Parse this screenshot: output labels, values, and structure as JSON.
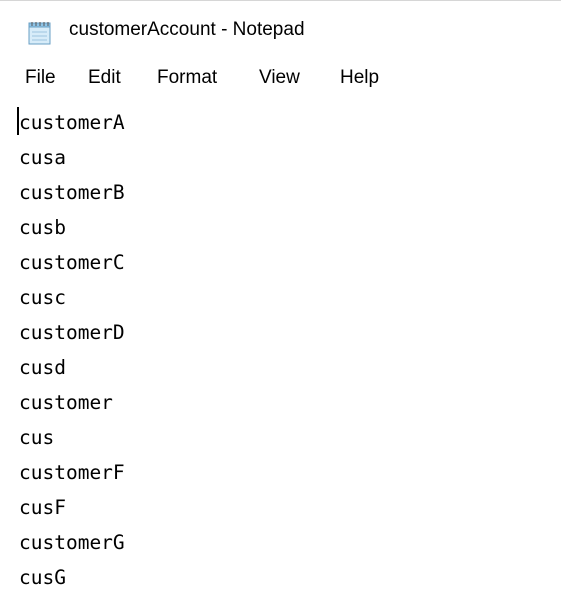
{
  "window": {
    "title": "customerAccount - Notepad",
    "icon": "notepad-icon"
  },
  "menu": {
    "file": "File",
    "edit": "Edit",
    "format": "Format",
    "view": "View",
    "help": "Help"
  },
  "editor": {
    "lines": [
      "customerA",
      "cusa",
      "customerB",
      "cusb",
      "customerC",
      "cusc",
      "customerD",
      "cusd",
      "customer",
      "cus",
      "customerF",
      "cusF",
      "customerG",
      "cusG"
    ]
  }
}
